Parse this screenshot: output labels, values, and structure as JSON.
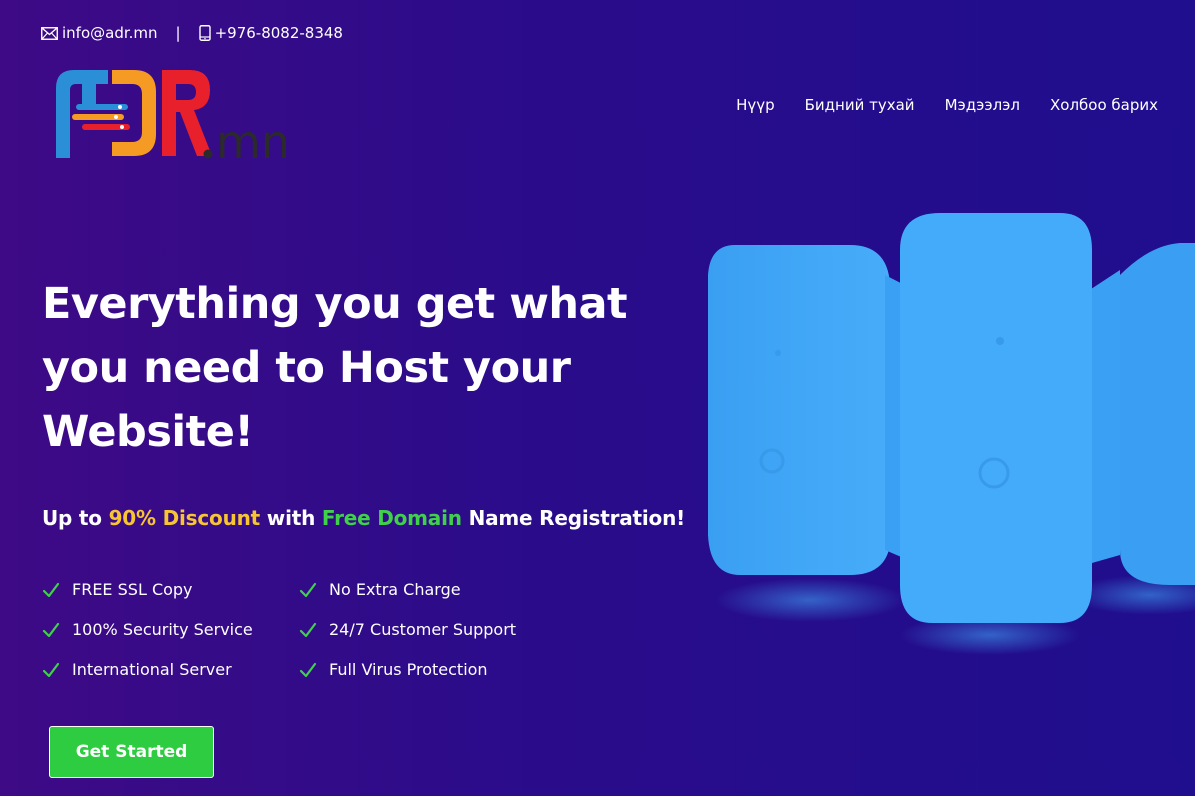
{
  "topbar": {
    "email": "info@adr.mn",
    "separator": "|",
    "phone": "+976-8082-8348"
  },
  "logo": {
    "text": "ADR.mn"
  },
  "nav": {
    "items": [
      {
        "label": "Нүүр"
      },
      {
        "label": "Бидний тухай"
      },
      {
        "label": "Мэдээлэл"
      },
      {
        "label": "Холбоо барих"
      }
    ]
  },
  "hero": {
    "headline": "Everything you get what you need to Host your Website!",
    "subline": {
      "part1": "Up to ",
      "discount": "90% Discount",
      "part2": " with ",
      "free": "Free Domain",
      "part3": " Name Registration!"
    },
    "features": [
      "FREE SSL Copy",
      "No Extra Charge",
      "100% Security Service",
      "24/7 Customer Support",
      "International Server",
      "Full Virus Protection"
    ],
    "cta_label": "Get Started"
  },
  "colors": {
    "accent_yellow": "#f7c531",
    "accent_green": "#3fd14a",
    "button_green": "#2ecc40",
    "server_blue": "#41a8f8",
    "background_start": "#3e0a86",
    "background_end": "#1f0e8e"
  },
  "icons": {
    "email": "envelope-icon",
    "phone": "mobile-phone-icon",
    "check": "check-icon"
  }
}
